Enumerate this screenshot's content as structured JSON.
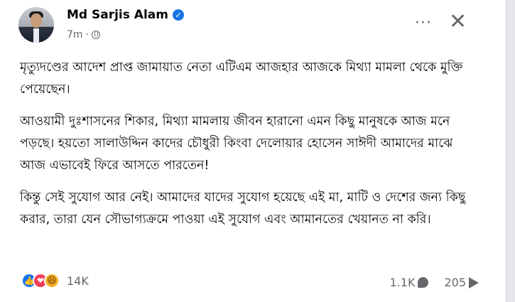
{
  "post": {
    "author_name": "Md Sarjis Alam",
    "time_ago": "7m",
    "paragraphs": [
      "মৃত্যুদণ্ডের আদেশ প্রাপ্ত জামায়াত নেতা এটিএম আজহার আজকে মিথ্যা মামলা থেকে মুক্তি পেয়েছেন।",
      "আওয়ামী দুঃশাসনের শিকার, মিথ্যা মামলায় জীবন হারানো এমন কিছু মানুষকে আজ মনে পড়ছে। হয়তো সালাউদ্দিন কাদের চৌধুরী কিংবা দেলোয়ার হোসেন সাঈদী আমাদের মাঝে আজ এভাবেই ফিরে আসতে পারতেন!",
      "কিন্তু সেই সুযোগ আর নেই। আমাদের যাদের সুযোগ হয়েছে এই মা, মাটি ও দেশের জন্য কিছু করার, তারা যেন সৌভাগ্যক্রমে পাওয়া এই সুযোগ এবং আমানতের খেয়ানত না করি।"
    ]
  },
  "icons": {
    "verified": "verified-badge-icon",
    "privacy": "globe-icon",
    "more": "more-options-icon",
    "close": "close-icon"
  },
  "glyphs": {
    "verified": "✓",
    "more": "···",
    "close": "✕",
    "like": "👍",
    "love": "❤",
    "haha": "😆"
  },
  "engagement": {
    "reaction_count": "14K",
    "comment_count": "1.1K",
    "share_count": "205"
  },
  "colors": {
    "accent": "#1b74e4",
    "secondary_text": "#65676b",
    "like": "#1877f2",
    "love": "#f33e58",
    "haha": "#f7b125"
  }
}
